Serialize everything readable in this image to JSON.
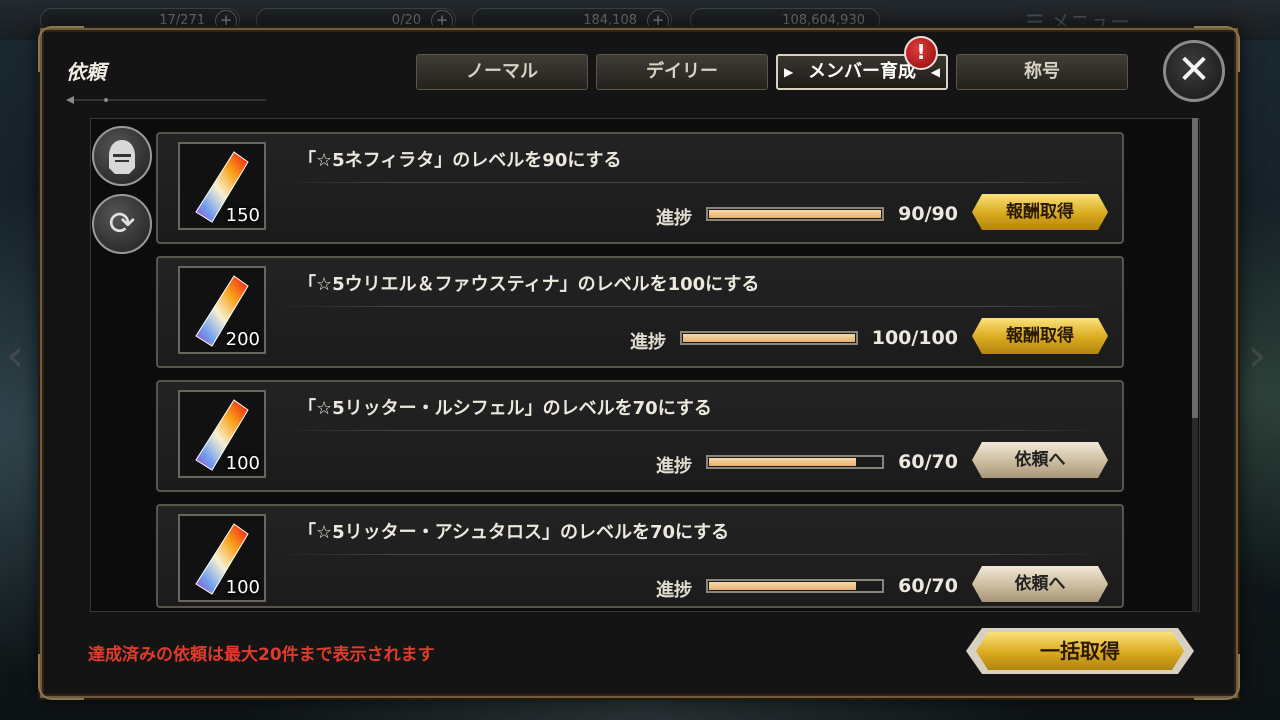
{
  "topbar": {
    "ap": "17/271",
    "bp": "0/20",
    "gold": "184,108",
    "coins": "108,604,930",
    "menu": "メニュー"
  },
  "dialog": {
    "title": "依頼",
    "tabs": [
      {
        "label": "ノーマル",
        "active": false
      },
      {
        "label": "デイリー",
        "active": false
      },
      {
        "label": "メンバー育成",
        "active": true
      },
      {
        "label": "称号",
        "active": false
      }
    ],
    "badge": "!",
    "close_icon": "close-icon"
  },
  "side_buttons": {
    "profile_icon": "knight-helmet-icon",
    "refresh_icon": "refresh-icon"
  },
  "progress_label": "進捗",
  "quests": [
    {
      "reward_qty": "150",
      "text": "「☆5ネフィラタ」のレベルを90にする",
      "current": 90,
      "target": 90,
      "progress": "90/90",
      "action": "報酬取得",
      "action_style": "gold"
    },
    {
      "reward_qty": "200",
      "text": "「☆5ウリエル＆ファウスティナ」のレベルを100にする",
      "current": 100,
      "target": 100,
      "progress": "100/100",
      "action": "報酬取得",
      "action_style": "gold"
    },
    {
      "reward_qty": "100",
      "text": "「☆5リッター・ルシフェル」のレベルを70にする",
      "current": 60,
      "target": 70,
      "progress": "60/70",
      "action": "依頼へ",
      "action_style": "beige"
    },
    {
      "reward_qty": "100",
      "text": "「☆5リッター・アシュタロス」のレベルを70にする",
      "current": 60,
      "target": 70,
      "progress": "60/70",
      "action": "依頼へ",
      "action_style": "beige"
    }
  ],
  "footer": {
    "note": "達成済みの依頼は最大20件まで表示されます",
    "bulk_button": "一括取得"
  },
  "colors": {
    "gold_button": "#d9a91e",
    "beige_button": "#c8b89a",
    "progress_fill": "#e6b070",
    "note_red": "#e03c2c",
    "badge_red": "#c41e1e"
  }
}
